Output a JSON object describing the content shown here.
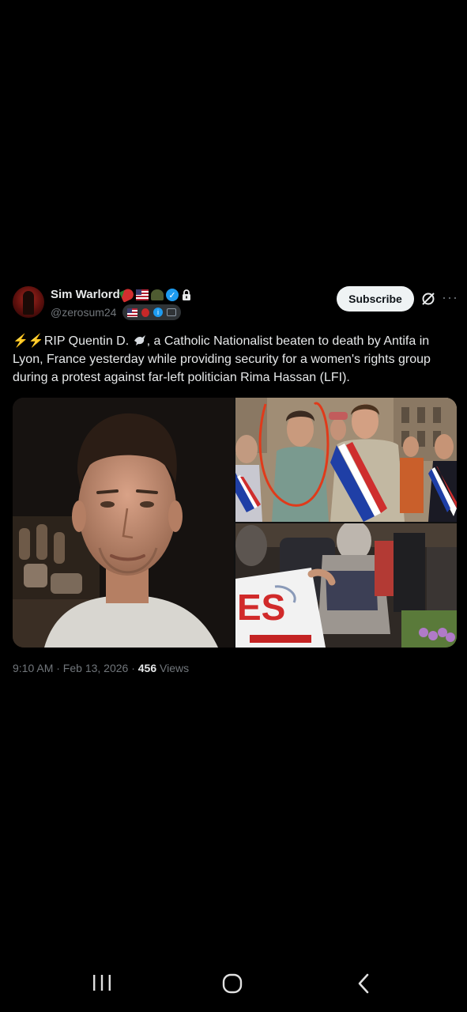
{
  "post": {
    "author": {
      "display_name": "Sim Warlord",
      "handle": "@zerosum24"
    },
    "subscribe_label": "Subscribe",
    "text": {
      "bolts": "⚡⚡",
      "part1": "RIP Quentin D. ",
      "part2": ", a Catholic Nationalist beaten to death by Antifa in Lyon, France yesterday while providing security for a women's rights group during a protest against far-left politician Rima Hassan (LFI)."
    },
    "banner_text": "ES",
    "footer": {
      "time_date": "9:10 AM · Feb 13, 2026 · ",
      "views_count": "456",
      "views_label": " Views"
    }
  },
  "icons": {
    "verified": "verified-checkmark-icon",
    "lock": "lock-icon",
    "grok": "grok-icon",
    "more": "more-options-icon"
  },
  "colors": {
    "background": "#000000",
    "text": "#e7e9ea",
    "muted": "#71767b",
    "verified": "#1d9bf0",
    "button_bg": "#eff3f4"
  }
}
